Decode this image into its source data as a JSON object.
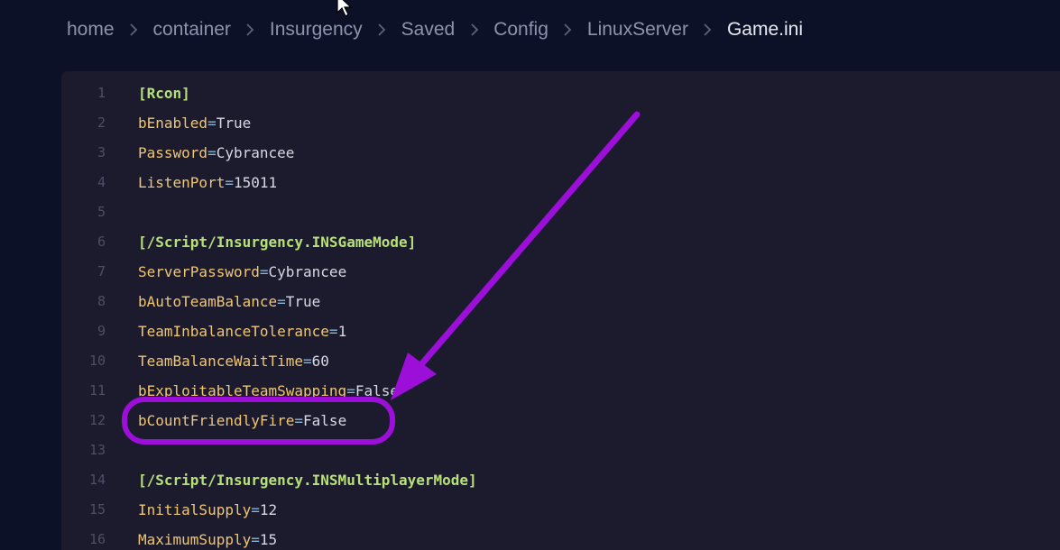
{
  "breadcrumb": {
    "items": [
      "home",
      "container",
      "Insurgency",
      "Saved",
      "Config",
      "LinuxServer"
    ],
    "current": "Game.ini"
  },
  "editor": {
    "lines": [
      {
        "n": "1",
        "section": "[Rcon]"
      },
      {
        "n": "2",
        "key": "bEnabled",
        "eq": "=",
        "value": "True"
      },
      {
        "n": "3",
        "key": "Password",
        "eq": "=",
        "value": "Cybrancee"
      },
      {
        "n": "4",
        "key": "ListenPort",
        "eq": "=",
        "value": "15011"
      },
      {
        "n": "5"
      },
      {
        "n": "6",
        "section": "[/Script/Insurgency.INSGameMode]"
      },
      {
        "n": "7",
        "key": "ServerPassword",
        "eq": "=",
        "value": "Cybrancee"
      },
      {
        "n": "8",
        "key": "bAutoTeamBalance",
        "eq": "=",
        "value": "True"
      },
      {
        "n": "9",
        "key": "TeamInbalanceTolerance",
        "eq": "=",
        "value": "1"
      },
      {
        "n": "10",
        "key": "TeamBalanceWaitTime",
        "eq": "=",
        "value": "60"
      },
      {
        "n": "11",
        "key": "bExploitableTeamSwapping",
        "eq": "=",
        "value": "False"
      },
      {
        "n": "12",
        "key": "bCountFriendlyFire",
        "eq": "=",
        "value": "False"
      },
      {
        "n": "13"
      },
      {
        "n": "14",
        "section": "[/Script/Insurgency.INSMultiplayerMode]"
      },
      {
        "n": "15",
        "key": "InitialSupply",
        "eq": "=",
        "value": "12"
      },
      {
        "n": "16",
        "key": "MaximumSupply",
        "eq": "=",
        "value": "15"
      }
    ]
  },
  "annotation": {
    "color": "#9b0fd9",
    "highlighted_line": "12"
  }
}
